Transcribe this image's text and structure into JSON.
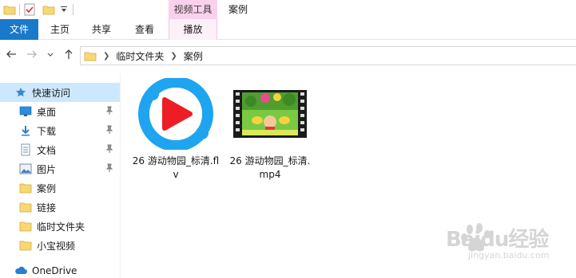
{
  "quick_access_toolbar": {
    "icons": [
      "folder-icon",
      "properties-check-icon",
      "folder-icon",
      "dropdown-arrow-icon"
    ]
  },
  "title_bar": {
    "contextual_tools_label": "视频工具",
    "window_title": "案例"
  },
  "ribbon": {
    "tabs": [
      {
        "label": "文件"
      },
      {
        "label": "主页"
      },
      {
        "label": "共享"
      },
      {
        "label": "查看"
      },
      {
        "label": "播放"
      }
    ]
  },
  "address_bar": {
    "breadcrumbs": [
      "临时文件夹",
      "案例"
    ]
  },
  "nav_pane": {
    "items": [
      {
        "label": "快速访问",
        "icon": "star-icon"
      },
      {
        "label": "桌面",
        "icon": "desktop-icon",
        "pinned": true
      },
      {
        "label": "下载",
        "icon": "download-icon",
        "pinned": true
      },
      {
        "label": "文档",
        "icon": "document-icon",
        "pinned": true
      },
      {
        "label": "图片",
        "icon": "picture-icon",
        "pinned": true
      },
      {
        "label": "案例",
        "icon": "folder-icon"
      },
      {
        "label": "链接",
        "icon": "folder-icon"
      },
      {
        "label": "临时文件夹",
        "icon": "folder-icon"
      },
      {
        "label": "小宝视频",
        "icon": "folder-icon"
      },
      {
        "label": "OneDrive",
        "icon": "cloud-icon"
      }
    ]
  },
  "files": [
    {
      "name": "26 游动物园_标清.flv",
      "icon": "youku-player-icon"
    },
    {
      "name": "26 游动物园_标清.mp4",
      "icon": "video-thumbnail-icon"
    }
  ],
  "watermark": {
    "brand": "Baidu经验",
    "url": "jingyan.baidu.com"
  },
  "colors": {
    "file_tab": "#1979ca",
    "contextual_tab": "#f9d1ec",
    "selected_nav": "#cce8ff",
    "folder": "#f8d775",
    "youku_blue": "#1fa4f0",
    "youku_red": "#ee1c24"
  }
}
